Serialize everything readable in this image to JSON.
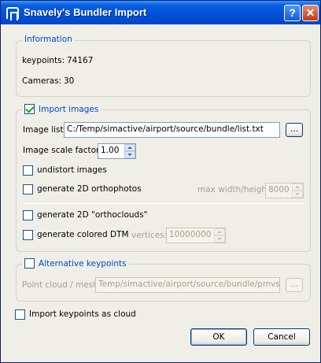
{
  "window": {
    "title": "Snavely's Bundler Import",
    "help_glyph": "?",
    "close_glyph": "✕"
  },
  "information": {
    "title": "Information",
    "keypoints_label": "keypoints:",
    "keypoints_value": "74167",
    "cameras_label": "Cameras:",
    "cameras_value": "30"
  },
  "import_images": {
    "title": "Import images",
    "checked": true,
    "image_list_label": "Image list",
    "image_list_value": "C:/Temp/simactive/airport/source/bundle/list.txt",
    "browse_label": "...",
    "scale_label": "Image scale factor",
    "scale_value": "1.00",
    "undistort_label": "undistort images",
    "orthophotos_label": "generate 2D orthophotos",
    "max_size_label": "max width/height",
    "max_size_value": "8000",
    "orthoclouds_label": "generate 2D \"orthoclouds\"",
    "dtm_label": "generate colored DTM",
    "vertices_label": "vertices:",
    "vertices_value": "10000000"
  },
  "alternative_keypoints": {
    "title": "Alternative keypoints",
    "checked": false,
    "cloud_label": "Point cloud / mesh",
    "cloud_value": "Temp/simactive/airport/source/bundle/pmvs.ply",
    "browse_label": "..."
  },
  "import_as_cloud_label": "Import keypoints as cloud",
  "buttons": {
    "ok": "OK",
    "cancel": "Cancel"
  },
  "colors": {
    "titlebar": "#0050d8",
    "group_title": "#0046d5",
    "window_bg": "#f0efe7"
  }
}
